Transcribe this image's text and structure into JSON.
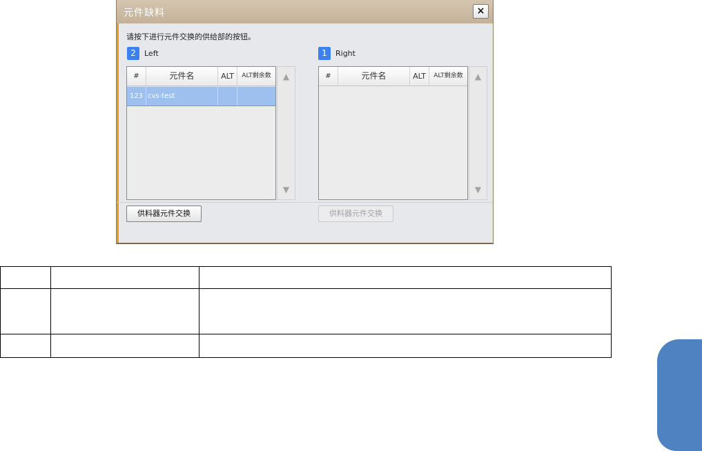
{
  "dialog": {
    "title": "元件缺料",
    "close_label": "×",
    "instruction": "请按下进行元件交换的供给部的按钮。",
    "columns": {
      "num": "#",
      "name": "元件名",
      "alt": "ALT",
      "alt_remaining": "ALT剩余数"
    },
    "left": {
      "badge": "2",
      "label": "Left",
      "rows": [
        {
          "num": "123",
          "name": "cvs-test",
          "alt": "",
          "alt_remaining": ""
        }
      ],
      "button_label": "供料器元件交换"
    },
    "right": {
      "badge": "1",
      "label": "Right",
      "rows": [],
      "button_label": "供料器元件交换"
    },
    "scroll_up": "▲",
    "scroll_down": "▼"
  },
  "colors": {
    "accent": "#3a82f2",
    "selected_row": "#9dc0ee",
    "side_tab": "#4f82c0"
  }
}
